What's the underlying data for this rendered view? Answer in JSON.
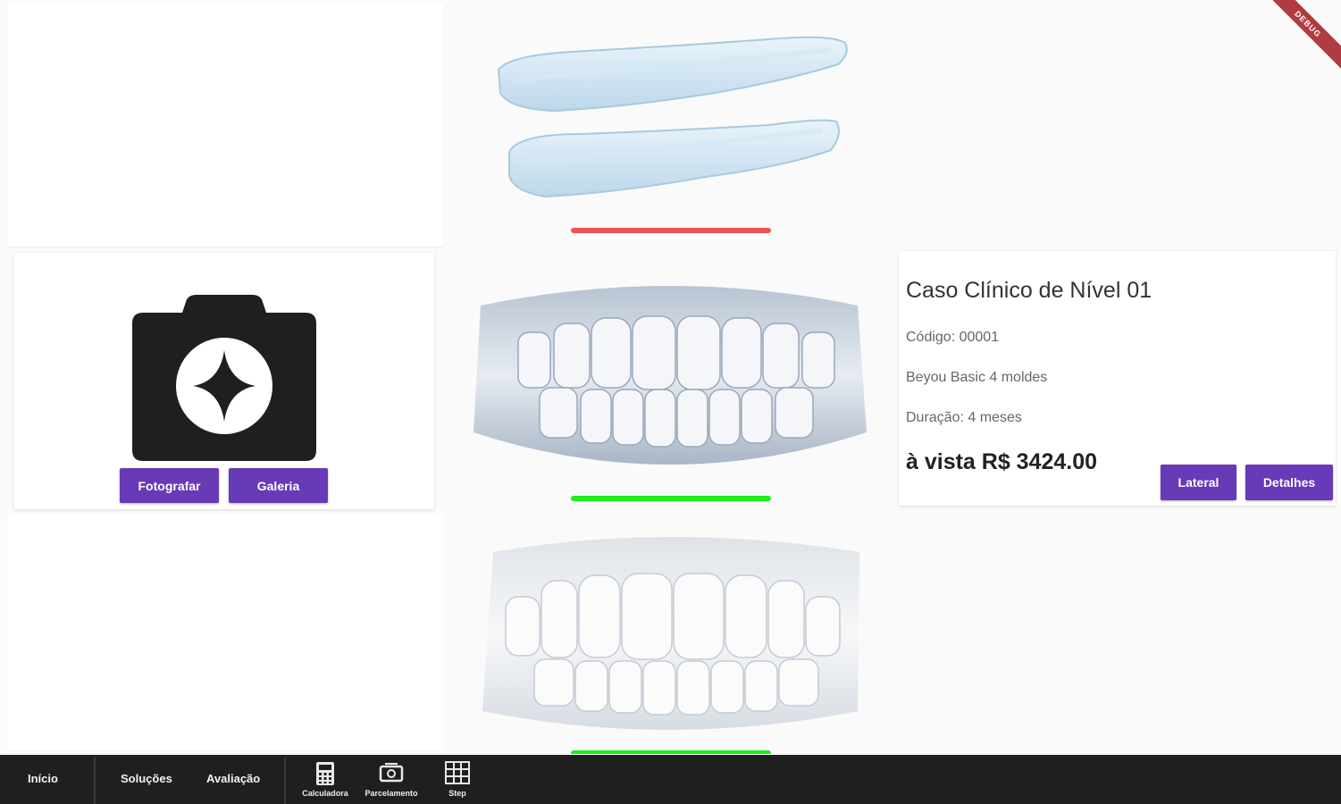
{
  "camera_card": {
    "photo_button": "Fotografar",
    "gallery_button": "Galeria"
  },
  "case": {
    "title": "Caso Clínico de Nível 01",
    "code": "Código: 00001",
    "plan": "Beyou Basic 4 moldes",
    "duration": "Duração: 4 meses",
    "price": "à vista R$ 3424.00",
    "lateral_button": "Lateral",
    "details_button": "Detalhes"
  },
  "tiles": [
    {
      "name": "aligner-image",
      "indicator_color": "#ef5350"
    },
    {
      "name": "front-teeth-image",
      "indicator_color": "#1aef1a"
    },
    {
      "name": "aligned-teeth-image",
      "indicator_color": "#1aef1a"
    }
  ],
  "bottom_nav": {
    "items": [
      {
        "label": "Início"
      },
      {
        "label": "Soluções"
      },
      {
        "label": "Avaliação"
      }
    ],
    "icon_items": [
      {
        "label": "Calculadora",
        "icon": "calculator-icon"
      },
      {
        "label": "Parcelamento",
        "icon": "money-icon"
      },
      {
        "label": "Step",
        "icon": "grid-icon"
      }
    ]
  },
  "debug_banner": "DEBUG",
  "colors": {
    "primary": "#673ab7",
    "nav_bg": "#1f1f1f"
  }
}
